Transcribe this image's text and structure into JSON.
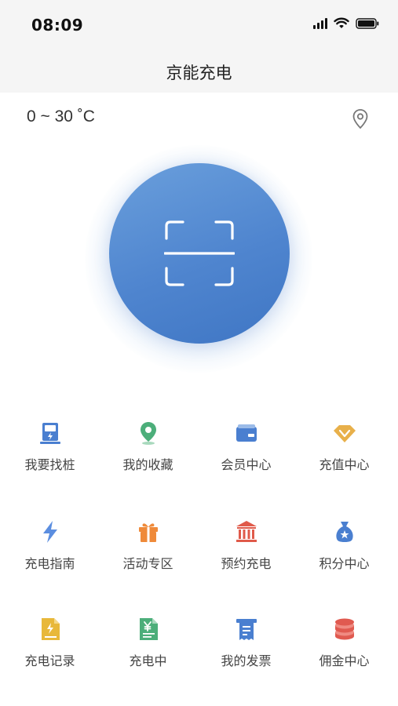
{
  "status_bar": {
    "time": "08:09"
  },
  "header": {
    "title": "京能充电"
  },
  "weather": {
    "temperature": "0 ~ 30 ˚C"
  },
  "scan": {
    "icon": "scan-icon"
  },
  "menu": [
    {
      "label": "我要找桩",
      "icon": "charging-pile-icon",
      "color": "#4a7fd0"
    },
    {
      "label": "我的收藏",
      "icon": "location-pin-icon",
      "color": "#4cae7a"
    },
    {
      "label": "会员中心",
      "icon": "member-card-icon",
      "color": "#4a7fd0"
    },
    {
      "label": "充值中心",
      "icon": "diamond-icon",
      "color": "#e8b04a"
    },
    {
      "label": "充电指南",
      "icon": "lightning-icon",
      "color": "#5b8ee0"
    },
    {
      "label": "活动专区",
      "icon": "gift-icon",
      "color": "#ef8a3a"
    },
    {
      "label": "预约充电",
      "icon": "building-icon",
      "color": "#e05a4a"
    },
    {
      "label": "积分中心",
      "icon": "money-bag-icon",
      "color": "#4a7fd0"
    },
    {
      "label": "充电记录",
      "icon": "record-doc-icon",
      "color": "#e8b83a"
    },
    {
      "label": "充电中",
      "icon": "yen-doc-icon",
      "color": "#4cae7a"
    },
    {
      "label": "我的发票",
      "icon": "receipt-icon",
      "color": "#4a7fd0"
    },
    {
      "label": "佣金中心",
      "icon": "coin-stack-icon",
      "color": "#e05a50"
    }
  ]
}
